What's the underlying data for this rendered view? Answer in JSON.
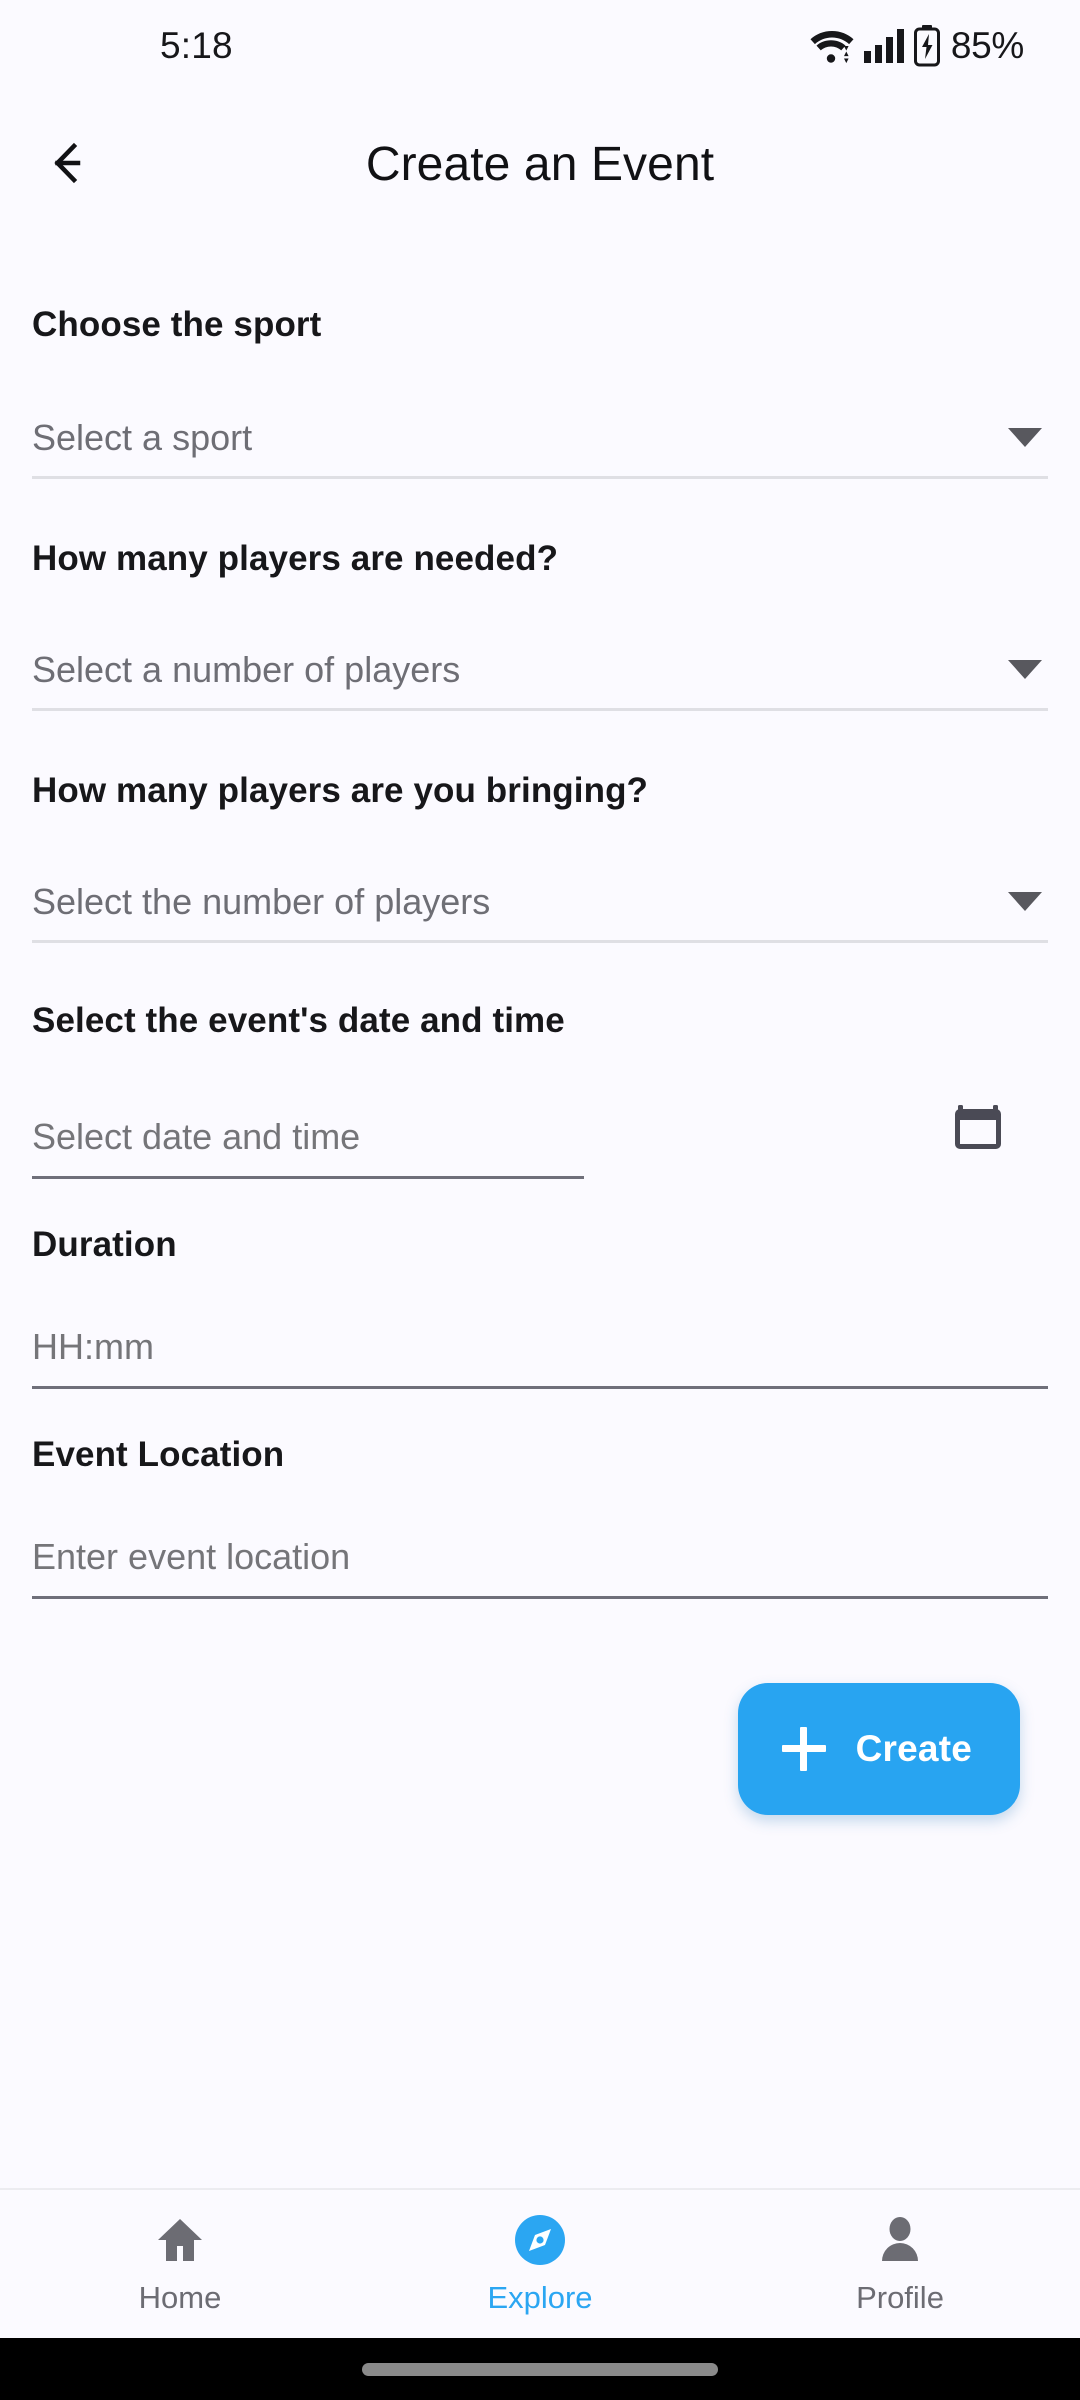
{
  "status_bar": {
    "time": "5:18",
    "battery_percent": "85%",
    "icons": [
      "wifi-icon",
      "cellular-signal-icon",
      "battery-charging-icon"
    ]
  },
  "app_bar": {
    "back_icon": "arrow-left-icon",
    "title": "Create an Event"
  },
  "form": {
    "fields": [
      {
        "label": "Choose the sport",
        "type": "select",
        "placeholder": "Select a sport",
        "value": "",
        "icon": "chevron-down-icon"
      },
      {
        "label": "How many players are needed?",
        "type": "select",
        "placeholder": "Select a number of players",
        "value": "",
        "icon": "chevron-down-icon"
      },
      {
        "label": "How many players are you bringing?",
        "type": "select",
        "placeholder": "Select the number of players",
        "value": "",
        "icon": "chevron-down-icon"
      },
      {
        "label": "Select the event's date and time",
        "type": "datetime",
        "placeholder": "Select date and time",
        "value": "",
        "icon": "calendar-icon"
      },
      {
        "label": "Duration",
        "type": "text",
        "placeholder": "HH:mm",
        "value": "",
        "icon": ""
      },
      {
        "label": "Event Location",
        "type": "text",
        "placeholder": "Enter event location",
        "value": "",
        "icon": ""
      }
    ]
  },
  "create_button": {
    "label": "Create",
    "icon": "plus-icon",
    "color": "#28a4f1",
    "text_color": "#ffffff"
  },
  "bottom_nav": {
    "active_color": "#2ba6f2",
    "inactive_color": "#6c6c73",
    "items": [
      {
        "label": "Home",
        "icon": "home-icon",
        "active": false
      },
      {
        "label": "Explore",
        "icon": "compass-icon",
        "active": true
      },
      {
        "label": "Profile",
        "icon": "person-icon",
        "active": false
      }
    ]
  }
}
